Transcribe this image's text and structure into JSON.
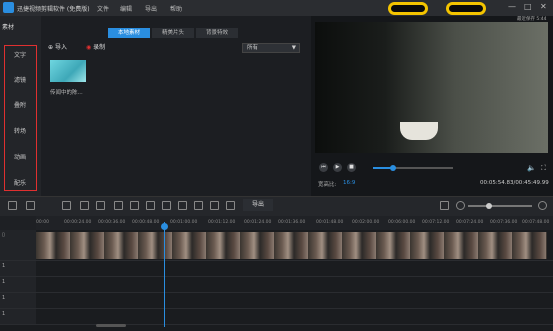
{
  "titlebar": {
    "app_title": "迅捷视频剪辑软件 (免费版)",
    "menus": [
      "文件",
      "编辑",
      "导出",
      "帮助"
    ],
    "window_controls": [
      "—",
      "□",
      "✕"
    ]
  },
  "sidebar": {
    "top_tab": "素材",
    "items": [
      "文字",
      "滤镜",
      "叠附",
      "转场",
      "动画",
      "配乐"
    ]
  },
  "media": {
    "tabs": [
      "本地素材",
      "精美片头",
      "背景特效"
    ],
    "active_tab": 0,
    "import_label": "导入",
    "record_label": "录制",
    "filter_value": "所有",
    "clip_name": "传闻中的陈..."
  },
  "preview": {
    "label": "最近保存 5:44",
    "ratio_label": "宽高比:",
    "ratio_value": "16:9",
    "time_current": "00:05:54.83",
    "time_total": "00:45:49.99",
    "progress": 0.25
  },
  "toolbar": {
    "export_label": "导出"
  },
  "timeline": {
    "ticks": [
      "00:00",
      "00:00:24.00",
      "00:00:36.00",
      "00:00:48.00",
      "00:01:00.00",
      "00:01:12.00",
      "00:01:24.00",
      "00:01:36.00",
      "00:01:48.00",
      "00:02:00.00",
      "00:06:00.00",
      "00:07:12.00",
      "00:07:24.00",
      "00:07:36.00",
      "00:07:48.00"
    ],
    "track_labels": [
      "1",
      "1",
      "1",
      "1"
    ]
  }
}
